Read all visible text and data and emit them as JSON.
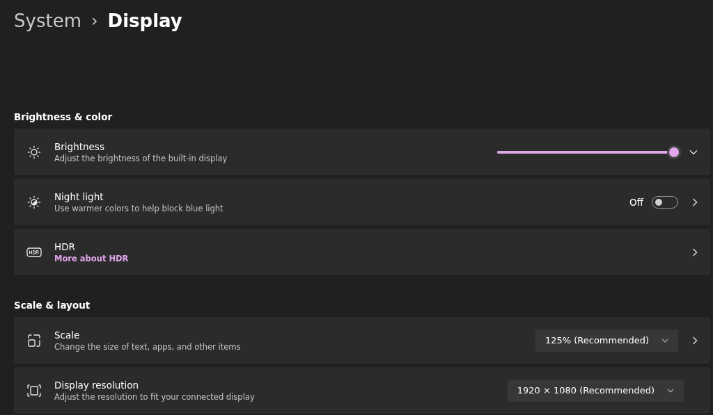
{
  "breadcrumb": {
    "parent": "System",
    "separator": "›",
    "current": "Display"
  },
  "sections": [
    {
      "heading": "Brightness & color",
      "rows": [
        {
          "kind": "slider",
          "title": "Brightness",
          "subtitle": "Adjust the brightness of the built-in display",
          "level": 1.0,
          "expandable": true,
          "opens_page": false
        },
        {
          "kind": "toggle",
          "title": "Night light",
          "subtitle": "Use warmer colors to help block blue light",
          "state_label": "Off",
          "on": false,
          "expandable": false,
          "opens_page": true
        },
        {
          "kind": "link",
          "title": "HDR",
          "link": "More about HDR",
          "expandable": false,
          "opens_page": true
        }
      ]
    },
    {
      "heading": "Scale & layout",
      "rows": [
        {
          "kind": "dropdown",
          "title": "Scale",
          "subtitle": "Change the size of text, apps, and other items",
          "value": "125% (Recommended)",
          "expandable": false,
          "opens_page": true
        },
        {
          "kind": "dropdown",
          "title": "Display resolution",
          "subtitle": "Adjust the resolution to fit your connected display",
          "value": "1920 × 1080 (Recommended)",
          "expandable": false,
          "opens_page": false
        }
      ]
    }
  ]
}
